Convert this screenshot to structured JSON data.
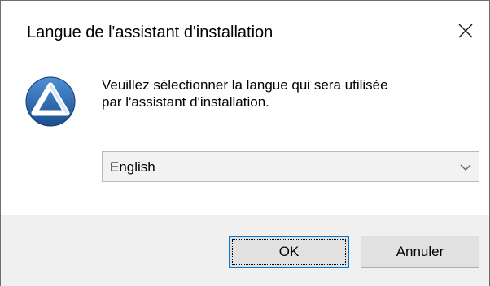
{
  "dialog": {
    "title": "Langue de l'assistant d'installation",
    "close_icon": "close-icon",
    "app_icon": "installer-logo-icon",
    "message_line1": "Veuillez sélectionner la langue qui sera utilisée",
    "message_line2": "par l'assistant d'installation.",
    "language_select": {
      "selected": "English",
      "chevron_icon": "chevron-down-icon"
    },
    "buttons": {
      "ok_label": "OK",
      "cancel_label": "Annuler"
    }
  },
  "colors": {
    "accent": "#0078d7",
    "logo_blue": "#1f5fa6",
    "footer_bg": "#f0f0f0",
    "button_bg": "#e1e1e1"
  }
}
